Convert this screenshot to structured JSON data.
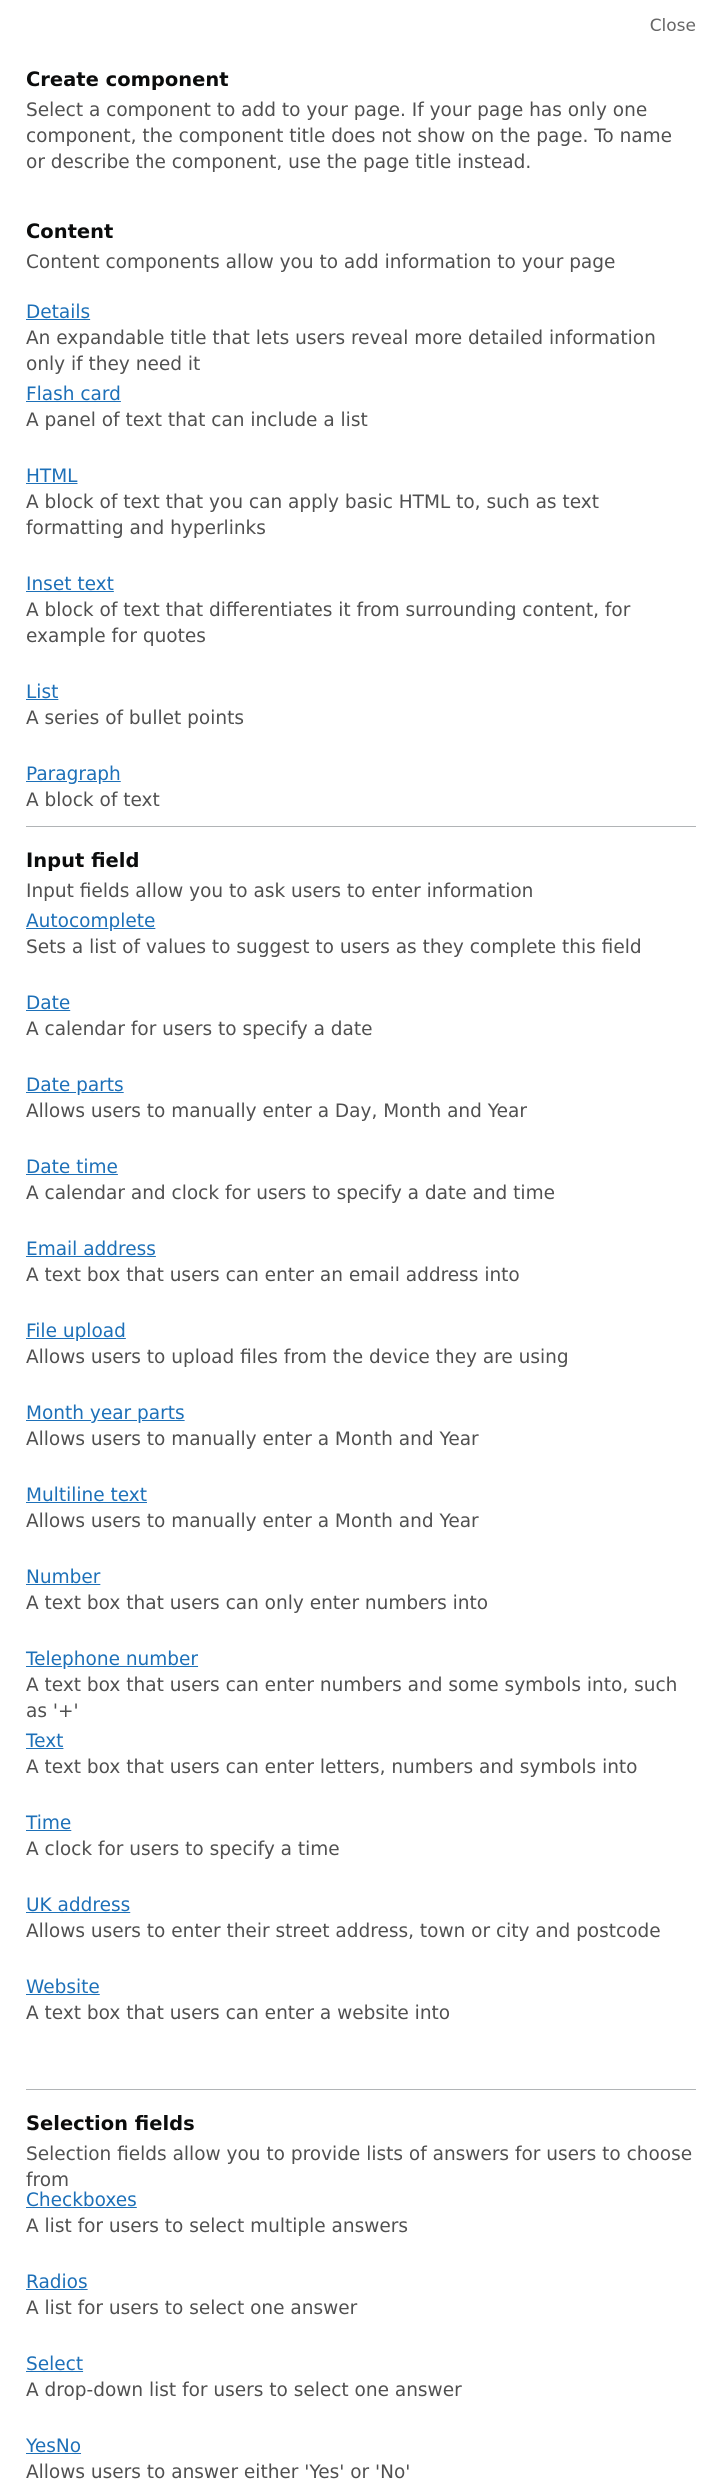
{
  "close_label": "Close",
  "header": {
    "title": "Create component",
    "intro": "Select a component to add to your page. If your page has only one component, the component title does not show on the page. To name or describe the component, use the page title instead."
  },
  "sections": [
    {
      "title": "Content",
      "intro": "Content components allow you to add information to your page",
      "items": [
        {
          "label": "Details",
          "desc": "An expandable title that lets users reveal more detailed information only if they need it"
        },
        {
          "label": "Flash card",
          "desc": "A panel of text that can include a list"
        },
        {
          "label": "HTML",
          "desc": "A block of text that you can apply basic HTML to, such as text formatting and hyperlinks"
        },
        {
          "label": "Inset text",
          "desc": "A block of text that differentiates it from surrounding content, for example for quotes"
        },
        {
          "label": "List",
          "desc": "A series of bullet points"
        },
        {
          "label": "Paragraph",
          "desc": "A block of text"
        }
      ]
    },
    {
      "title": "Input field",
      "intro": "Input fields allow you to ask users to enter information",
      "items": [
        {
          "label": "Autocomplete",
          "desc": "Sets a list of values to suggest to users as they complete this field"
        },
        {
          "label": "Date",
          "desc": "A calendar for users to specify a date"
        },
        {
          "label": "Date parts",
          "desc": "Allows users to manually enter a Day, Month and Year"
        },
        {
          "label": "Date time",
          "desc": "A calendar and clock for users to specify a date and time"
        },
        {
          "label": "Email address",
          "desc": "A text box that users can enter an email address into"
        },
        {
          "label": "File upload",
          "desc": "Allows users to upload files from the device they are using"
        },
        {
          "label": "Month year parts",
          "desc": "Allows users to manually enter a Month and Year"
        },
        {
          "label": "Multiline text",
          "desc": "Allows users to manually enter a Month and Year"
        },
        {
          "label": "Number",
          "desc": "A text box that users can only enter numbers into"
        },
        {
          "label": "Telephone number",
          "desc": "A text box that users can enter numbers and some symbols into, such as '+'"
        },
        {
          "label": "Text",
          "desc": "A text box that users can enter letters, numbers and symbols into"
        },
        {
          "label": "Time",
          "desc": "A clock for users to specify a time"
        },
        {
          "label": "UK address",
          "desc": "Allows users to enter their street address, town or city and postcode"
        },
        {
          "label": "Website",
          "desc": "A text box that users can enter a website into"
        }
      ]
    },
    {
      "title": "Selection fields",
      "intro": "Selection fields allow you to provide lists of answers for users to choose from",
      "items": [
        {
          "label": "Checkboxes",
          "desc": "A list for users to select multiple answers"
        },
        {
          "label": "Radios",
          "desc": "A list for users to select one answer"
        },
        {
          "label": "Select",
          "desc": "A drop-down list for users to select one answer"
        },
        {
          "label": "YesNo",
          "desc": "Allows users to answer either 'Yes' or 'No'"
        }
      ]
    }
  ]
}
